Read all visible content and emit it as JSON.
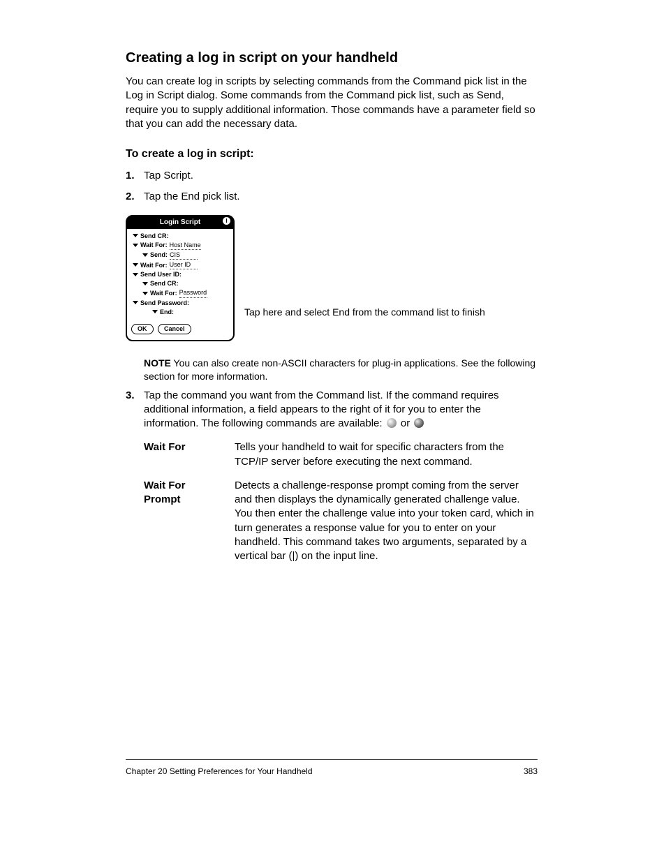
{
  "heading": "Creating a log in script on your handheld",
  "para1": "You can create log in scripts by selecting commands from the Command pick list in the Log in Script dialog. Some commands from the Command pick list, such as Send, require you to supply additional information. Those commands have a parameter field so that you can add the necessary data.",
  "subheading": "To create a log in script:",
  "steps": [
    "Tap Script.",
    "Tap the End pick list."
  ],
  "step3_lead": "Tap the command you want from the Command list. If the command requires additional information, a field appears to the right of it for you to enter the information. The following commands are available:",
  "nav_between": " or ",
  "note_label": "NOTE",
  "note_text": "  You can also create non-ASCII characters for plug-in applications. See the following section for more information.",
  "device": {
    "title": "Login Script",
    "rows": [
      {
        "indent": "i1",
        "label": "Send CR:",
        "value": ""
      },
      {
        "indent": "i1",
        "label": "Wait For:",
        "value": "Host Name"
      },
      {
        "indent": "i2",
        "label": "Send:",
        "value": "CIS"
      },
      {
        "indent": "i1",
        "label": "Wait For:",
        "value": "User ID"
      },
      {
        "indent": "i1",
        "label": "Send User ID:",
        "value": ""
      },
      {
        "indent": "i2",
        "label": "Send CR:",
        "value": ""
      },
      {
        "indent": "i2",
        "label": "Wait For:",
        "value": "Password"
      },
      {
        "indent": "i1",
        "label": "Send Password:",
        "value": ""
      },
      {
        "indent": "i3",
        "label": "End:",
        "value": "",
        "noTri": false
      }
    ],
    "ok": "OK",
    "cancel": "Cancel"
  },
  "caption": "Tap here and select End from the command list to finish",
  "commands": {
    "waitfor": {
      "name": "Wait For",
      "desc": "Tells your handheld to wait for specific characters from the TCP/IP server before executing the next command."
    },
    "waitprompt": {
      "name": "Wait For Prompt",
      "desc": "Detects a challenge-response prompt coming from the server and then displays the dynamically generated challenge value. You then enter the challenge value into your token card, which in turn generates a response value for you to enter on your handheld. This command takes two arguments, separated by a vertical bar (|) on the input line."
    }
  },
  "footer_left": "Chapter 20 Setting Preferences for Your Handheld",
  "footer_right": "383"
}
